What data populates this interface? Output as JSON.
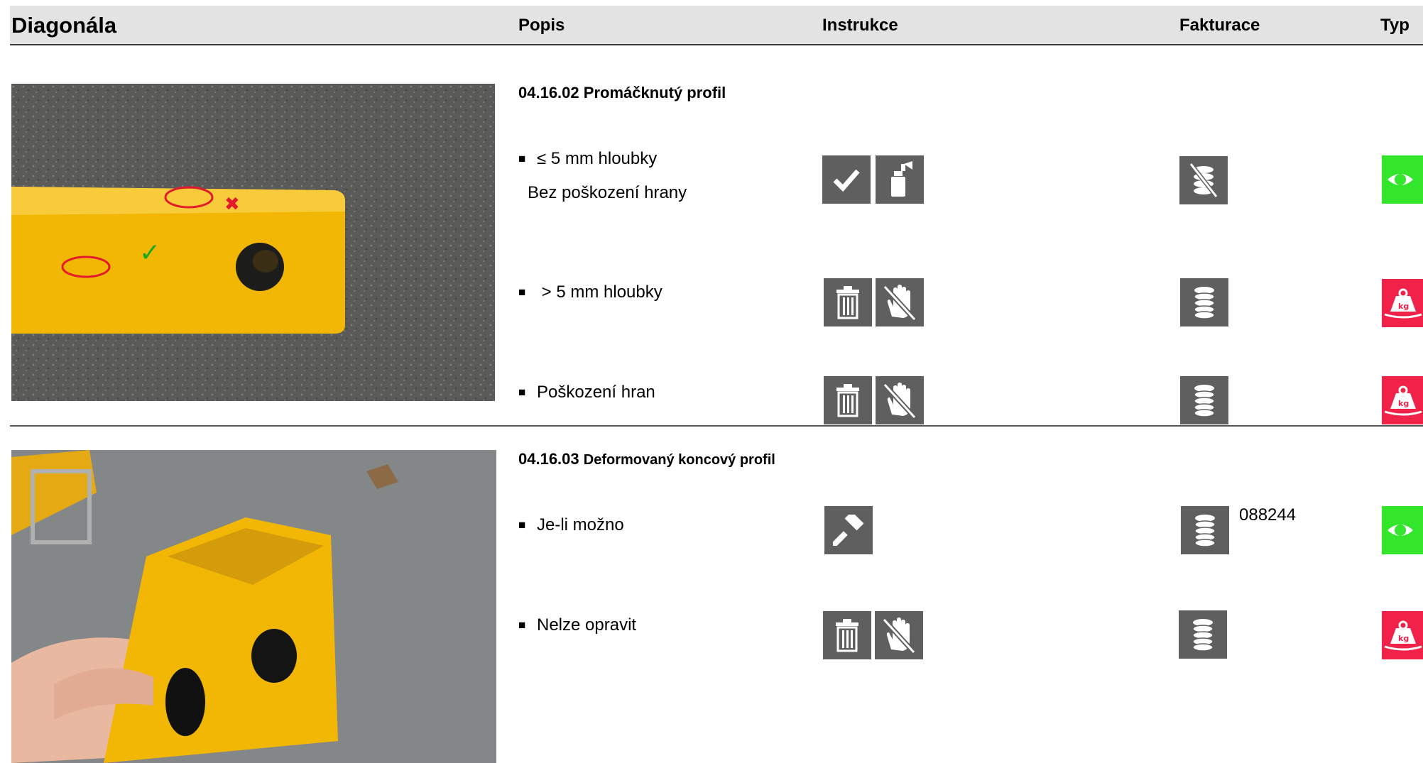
{
  "header": {
    "title": "Diagonála",
    "col_popis": "Popis",
    "col_instrukce": "Instrukce",
    "col_fakturace": "Fakturace",
    "col_typ": "Typ"
  },
  "sections": [
    {
      "code": "04.16.02",
      "title": "Promáčknutý profil",
      "rows": [
        {
          "text": "≤ 5 mm hloubky",
          "subtext": "Bez poškození hrany",
          "instructions": [
            "check-icon",
            "spray-can-icon"
          ],
          "billing": "no-coins-icon",
          "billing_ref": "",
          "type": "inspect-eye-icon",
          "type_color": "#34e62b"
        },
        {
          "text": " > 5 mm hloubky",
          "subtext": "",
          "instructions": [
            "trash-icon",
            "no-touch-icon"
          ],
          "billing": "coins-icon",
          "billing_ref": "",
          "type": "weight-kg-icon",
          "type_color": "#f0224a"
        },
        {
          "text": "Poškození hran",
          "subtext": "",
          "instructions": [
            "trash-icon",
            "no-touch-icon"
          ],
          "billing": "coins-icon",
          "billing_ref": "",
          "type": "weight-kg-icon",
          "type_color": "#f0224a"
        }
      ]
    },
    {
      "code": "04.16.03",
      "title": "Deformovaný koncový profil",
      "rows": [
        {
          "text": "Je-li možno",
          "subtext": "",
          "instructions": [
            "hammer-icon"
          ],
          "billing": "coins-icon",
          "billing_ref": "088244",
          "type": "inspect-eye-icon",
          "type_color": "#34e62b"
        },
        {
          "text": "Nelze opravit",
          "subtext": "",
          "instructions": [
            "trash-icon",
            "no-touch-icon"
          ],
          "billing": "coins-icon",
          "billing_ref": "",
          "type": "weight-kg-icon",
          "type_color": "#f0224a"
        }
      ]
    }
  ],
  "bullet": "■",
  "colors": {
    "icon_bg": "#5f5f5f",
    "ok": "#34e62b",
    "scrap": "#f0224a",
    "header_bg": "#e3e3e3"
  }
}
